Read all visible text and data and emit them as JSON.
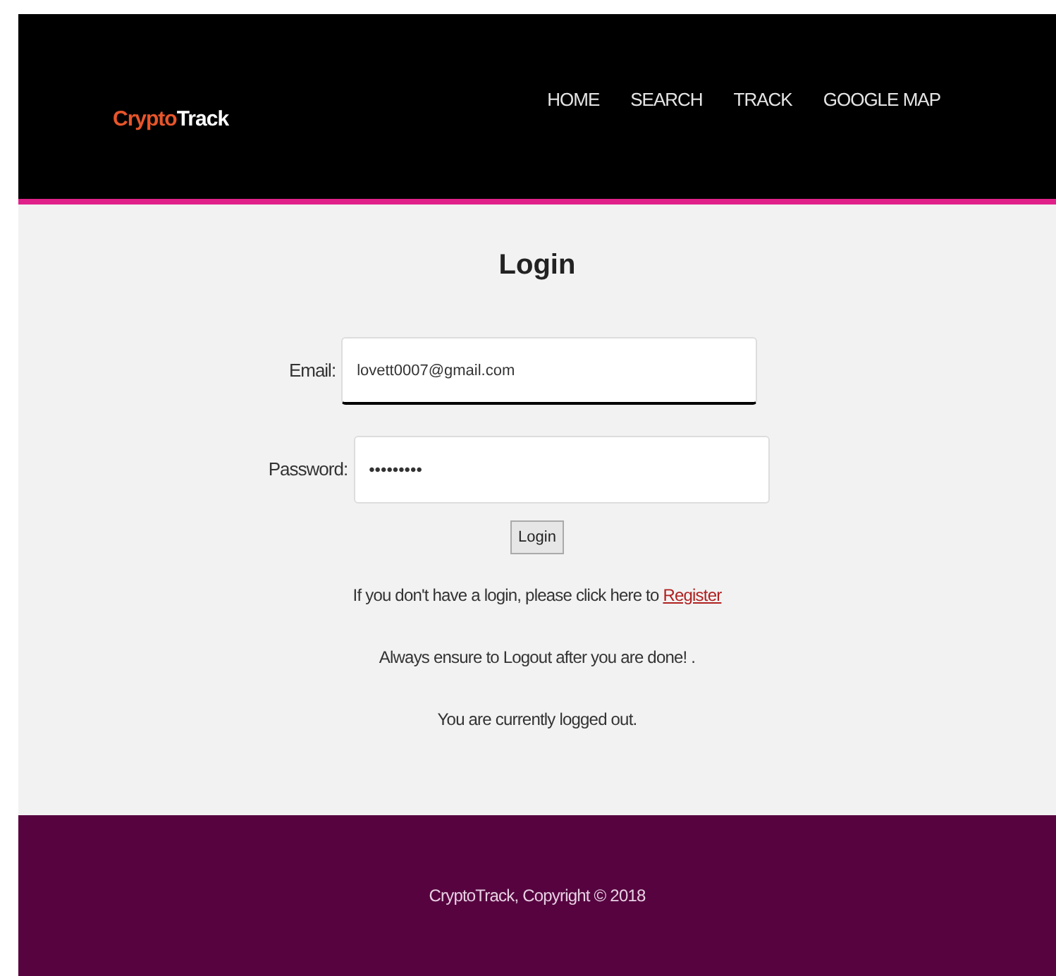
{
  "header": {
    "logo": {
      "part_1": "Crypto",
      "part_2": "Track"
    },
    "nav": [
      "HOME",
      "SEARCH",
      "TRACK",
      "GOOGLE MAP"
    ]
  },
  "login": {
    "title": "Login",
    "fields": [
      {
        "label": "Email:",
        "value": "lovett0007@gmail.com"
      },
      {
        "label": "Password:",
        "value": "•••••••••"
      }
    ],
    "button": "Login",
    "register_text": "If you don't have a login, please click here to",
    "register_link": "Register",
    "notes": [
      "Always ensure to Logout after you are done! .",
      "You are currently logged out."
    ]
  },
  "footer": {
    "text": "CryptoTrack, Copyright © 2018"
  }
}
